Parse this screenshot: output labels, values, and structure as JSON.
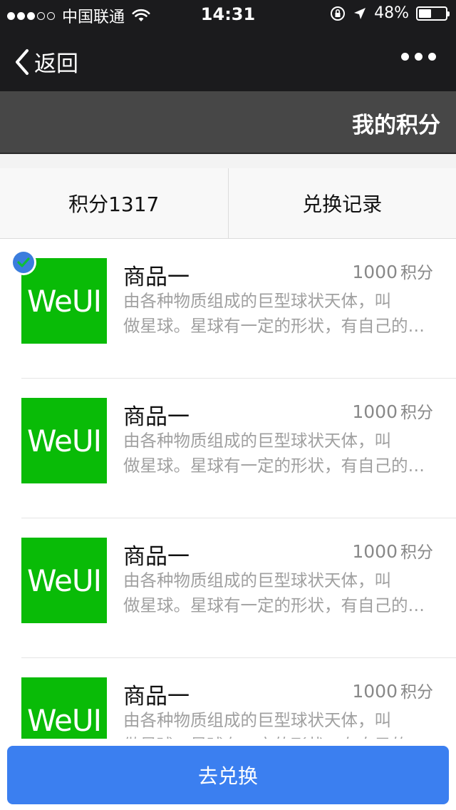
{
  "status_bar": {
    "carrier": "中国联通",
    "time": "14:31",
    "battery": "48%",
    "battery_level": 0.48,
    "signal_bars": 3,
    "signal_total": 5
  },
  "nav": {
    "back_label": "返回"
  },
  "header": {
    "title": "我的积分"
  },
  "tabs": [
    {
      "label": "积分1317"
    },
    {
      "label": "兑换记录"
    }
  ],
  "products": [
    {
      "image_text": "WeUI",
      "name": "商品一",
      "points": "1000",
      "unit": "积分",
      "desc_line1": "由各种物质组成的巨型球状天体，叫",
      "desc_line2": "做星球。星球有一定的形状，有自己的运行轨道",
      "selected": true
    },
    {
      "image_text": "WeUI",
      "name": "商品一",
      "points": "1000",
      "unit": "积分",
      "desc_line1": "由各种物质组成的巨型球状天体，叫",
      "desc_line2": "做星球。星球有一定的形状，有自己的运行轨道",
      "selected": false
    },
    {
      "image_text": "WeUI",
      "name": "商品一",
      "points": "1000",
      "unit": "积分",
      "desc_line1": "由各种物质组成的巨型球状天体，叫",
      "desc_line2": "做星球。星球有一定的形状，有自己的运行轨道",
      "selected": false
    },
    {
      "image_text": "WeUI",
      "name": "商品一",
      "points": "1000",
      "unit": "积分",
      "desc_line1": "由各种物质组成的巨型球状天体，叫",
      "desc_line2": "做星球。星球有一定的形状，有自己的运行轨道",
      "selected": false
    }
  ],
  "action": {
    "button_label": "去兑换"
  },
  "colors": {
    "thumb": "#09bb07",
    "primary": "#3b7ff0",
    "nav_bg": "#1b1b1d",
    "title_bg": "#474747"
  }
}
